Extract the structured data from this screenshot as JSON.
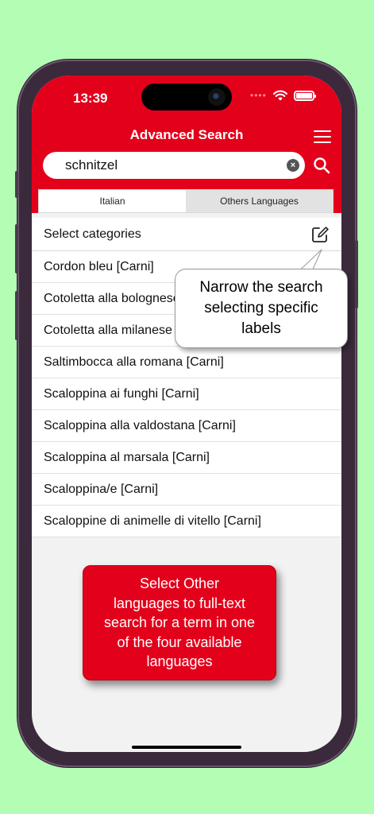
{
  "status": {
    "time": "13:39"
  },
  "header": {
    "title": "Advanced Search"
  },
  "search": {
    "value": "schnitzel",
    "placeholder": "Search"
  },
  "tabs": [
    {
      "label": "Italian",
      "active": false
    },
    {
      "label": "Others Languages",
      "active": true
    }
  ],
  "categories": {
    "label": "Select categories"
  },
  "results": [
    "Cordon bleu [Carni]",
    "Cotoletta alla bolognese [Carni]",
    "Cotoletta alla milanese [Carni]",
    "Saltimbocca alla romana [Carni]",
    "Scaloppina ai funghi [Carni]",
    "Scaloppina alla valdostana [Carni]",
    "Scaloppina al marsala [Carni]",
    "Scaloppina/e [Carni]",
    "Scaloppine di animelle di vitello [Carni]"
  ],
  "callouts": {
    "bubble": [
      "Narrow the search",
      "selecting specific",
      "labels"
    ],
    "card": [
      "Select Other",
      "languages to full-text",
      "search for a term in one",
      "of the four available",
      "languages"
    ]
  },
  "colors": {
    "brand_red": "#e3001b",
    "background_green": "#b3fdb4"
  }
}
